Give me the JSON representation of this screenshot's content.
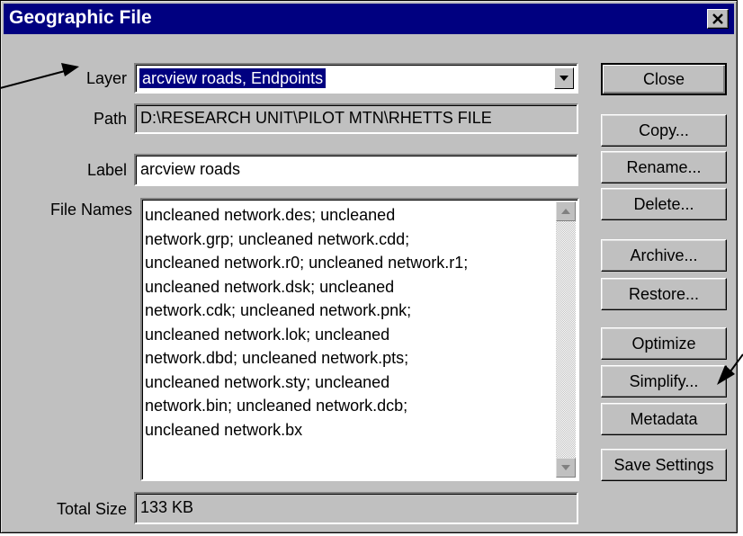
{
  "window": {
    "title": "Geographic File",
    "close_glyph": "✕"
  },
  "form": {
    "layer_label": "Layer",
    "layer_value": "arcview roads, Endpoints",
    "path_label": "Path",
    "path_value": "D:\\RESEARCH UNIT\\PILOT MTN\\RHETTS FILE",
    "label_label": "Label",
    "label_value": "arcview roads",
    "filenames_label": "File Names",
    "filenames_value": "uncleaned network.des; uncleaned\nnetwork.grp; uncleaned network.cdd;\nuncleaned network.r0; uncleaned network.r1;\nuncleaned network.dsk; uncleaned\nnetwork.cdk; uncleaned network.pnk;\nuncleaned network.lok; uncleaned\nnetwork.dbd; uncleaned network.pts;\nuncleaned network.sty; uncleaned\nnetwork.bin; uncleaned network.dcb;\nuncleaned network.bx",
    "totalsize_label": "Total Size",
    "totalsize_value": "133 KB"
  },
  "buttons": {
    "close": "Close",
    "copy": "Copy...",
    "rename": "Rename...",
    "delete": "Delete...",
    "archive": "Archive...",
    "restore": "Restore...",
    "optimize": "Optimize",
    "simplify": "Simplify...",
    "metadata": "Metadata",
    "save_settings": "Save Settings"
  },
  "icons": {
    "dropdown": "chevron-down-icon",
    "scroll_up": "scroll-up-icon",
    "scroll_down": "scroll-down-icon",
    "pointer_left": "pointer-arrow-icon",
    "pointer_right": "pointer-arrow-icon"
  }
}
